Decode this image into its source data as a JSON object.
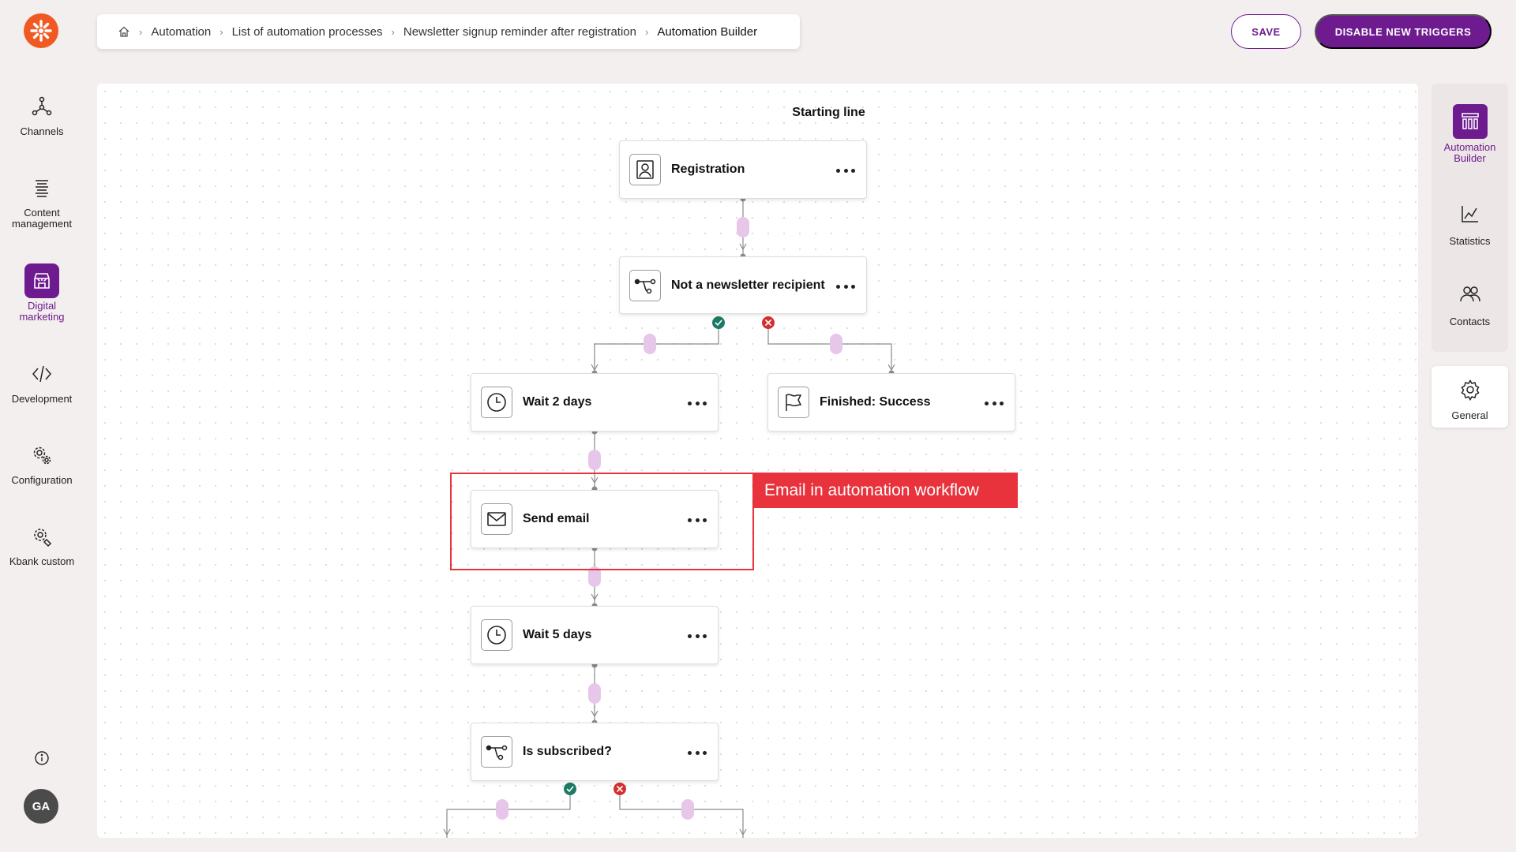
{
  "nav": {
    "logo_icon": "kentico-logo-icon",
    "items": [
      {
        "label": "Channels",
        "icon": "channels-icon"
      },
      {
        "label": "Content management",
        "icon": "content-icon"
      },
      {
        "label": "Digital marketing",
        "icon": "store-icon",
        "active": true
      },
      {
        "label": "Development",
        "icon": "code-icon"
      },
      {
        "label": "Configuration",
        "icon": "cogwheels-icon"
      },
      {
        "label": "Kbank custom",
        "icon": "custom-cog-icon"
      }
    ],
    "info_icon": "info-icon",
    "avatar": "GA"
  },
  "breadcrumb": {
    "home_icon": "home-icon",
    "items": [
      "Automation",
      "List of automation processes",
      "Newsletter signup reminder after registration",
      "Automation Builder"
    ]
  },
  "header": {
    "save_label": "SAVE",
    "disable_label": "DISABLE NEW TRIGGERS"
  },
  "canvas": {
    "starting_line": "Starting line",
    "nodes": [
      {
        "label": "Registration",
        "icon": "user-frame-icon"
      },
      {
        "label": "Not a newsletter recipient",
        "icon": "branch-icon"
      },
      {
        "label": "Wait 2 days",
        "icon": "clock-icon"
      },
      {
        "label": "Finished: Success",
        "icon": "flag-icon"
      },
      {
        "label": "Send email",
        "icon": "envelope-icon"
      },
      {
        "label": "Wait 5 days",
        "icon": "clock-icon"
      },
      {
        "label": "Is subscribed?",
        "icon": "branch-icon"
      }
    ],
    "highlight_label": "Email in automation workflow",
    "colors": {
      "yes": "#1d7a64",
      "no": "#d3302f",
      "add": "#e6c6e9",
      "link": "#8a8a8a"
    }
  },
  "right_panel": {
    "items": [
      {
        "label": "Automation Builder",
        "icon": "builder-icon",
        "active": true
      },
      {
        "label": "Statistics",
        "icon": "chart-icon"
      },
      {
        "label": "Contacts",
        "icon": "contacts-icon"
      }
    ],
    "general": {
      "label": "General",
      "icon": "gear-icon"
    }
  },
  "theme": {
    "accent": "#6e1b8f",
    "brand": "#f05a22",
    "highlight": "#e8323c"
  }
}
